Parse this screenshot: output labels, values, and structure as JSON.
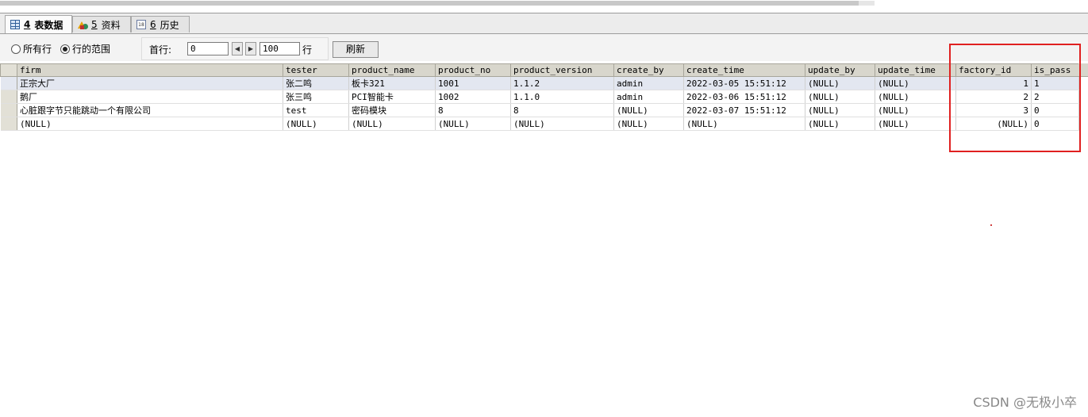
{
  "tabs": [
    {
      "num": "4",
      "label": "表数据",
      "icon": "table-grid-icon"
    },
    {
      "num": "5",
      "label": "资料",
      "icon": "info-shapes-icon"
    },
    {
      "num": "6",
      "label": "历史",
      "icon": "calendar-icon",
      "icon_text": "18"
    }
  ],
  "toolbar": {
    "all_rows_label": "所有行",
    "row_range_label": "行的范围",
    "selected_option": "行的范围",
    "first_row_label": "首行:",
    "first_row_value": "0",
    "row_count_value": "100",
    "rows_suffix": "行",
    "refresh_label": "刷新"
  },
  "table": {
    "columns": [
      "firm",
      "tester",
      "product_name",
      "product_no",
      "product_version",
      "create_by",
      "create_time",
      "update_by",
      "update_time",
      "factory_id",
      "is_pass"
    ],
    "rows": [
      [
        "正宗大厂",
        "张二鸣",
        "板卡321",
        "1001",
        "1.1.2",
        "admin",
        "2022-03-05 15:51:12",
        "(NULL)",
        "(NULL)",
        "1",
        "1"
      ],
      [
        "鹅厂",
        "张三鸣",
        "PCI智能卡",
        "1002",
        "1.1.0",
        "admin",
        "2022-03-06 15:51:12",
        "(NULL)",
        "(NULL)",
        "2",
        "2"
      ],
      [
        "心脏跟字节只能跳动一个有限公司",
        "test",
        "密码模块",
        "8",
        "8",
        "(NULL)",
        "2022-03-07 15:51:12",
        "(NULL)",
        "(NULL)",
        "3",
        "0"
      ],
      [
        "(NULL)",
        "(NULL)",
        "(NULL)",
        "(NULL)",
        "(NULL)",
        "(NULL)",
        "(NULL)",
        "(NULL)",
        "(NULL)",
        "(NULL)",
        "0"
      ]
    ]
  },
  "colors": {
    "highlight": "#e02020",
    "header_bg": "#d8d6cc",
    "selected_row": "#e3e7f0"
  },
  "watermark": "CSDN @无极小卒"
}
